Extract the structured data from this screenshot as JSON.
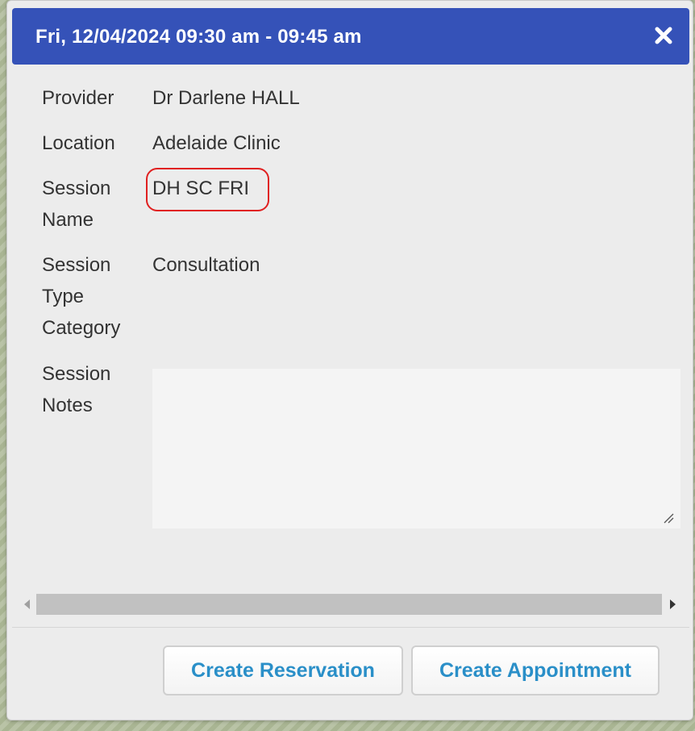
{
  "dialog": {
    "title": "Fri, 12/04/2024 09:30 am - 09:45 am",
    "close_icon": "close-icon"
  },
  "details": {
    "provider_label": "Provider",
    "provider_value": "Dr Darlene HALL",
    "location_label": "Location",
    "location_value": "Adelaide Clinic",
    "session_name_label_1": "Session",
    "session_name_label_2": "Name",
    "session_name_value": "DH SC FRI",
    "session_type_label_1": "Session",
    "session_type_label_2": "Type",
    "session_type_label_3": "Category",
    "session_type_value": "Consultation",
    "session_notes_label_1": "Session",
    "session_notes_label_2": "Notes",
    "session_notes_value": ""
  },
  "colors": {
    "titlebar": "#3552b8",
    "button_text": "#2a8fc8",
    "highlight": "#e02020"
  },
  "footer": {
    "create_reservation_label": "Create Reservation",
    "create_appointment_label": "Create Appointment"
  }
}
